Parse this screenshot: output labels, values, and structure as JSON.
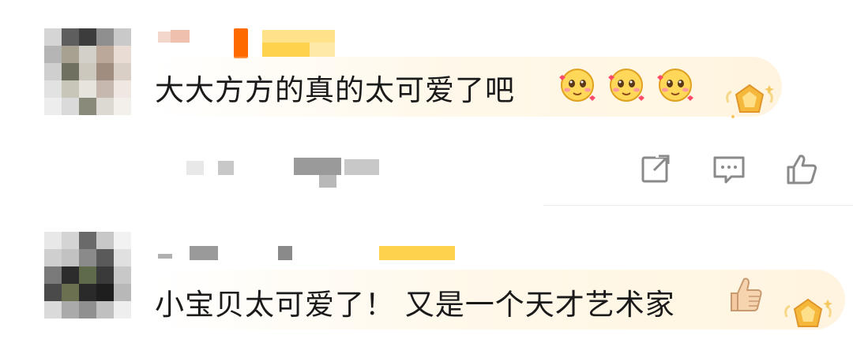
{
  "comments": [
    {
      "text": "大大方方的真的太可爱了吧",
      "emoji": [
        "cute-blush-face",
        "cute-blush-face",
        "cute-blush-face"
      ],
      "badge": "crown-badge",
      "actions": [
        "share-icon",
        "comment-icon",
        "like-icon"
      ]
    },
    {
      "text": "小宝贝太可爱了！ 又是一个天才艺术家",
      "emoji": [
        "thumbs-up"
      ],
      "badge": "crown-badge"
    }
  ],
  "colors": {
    "text": "#1a1a1a",
    "bubble": "#fff4df",
    "icon": "#8a8a8a",
    "badge_gold": "#f5b83a",
    "accent_orange": "#ff6a00"
  }
}
